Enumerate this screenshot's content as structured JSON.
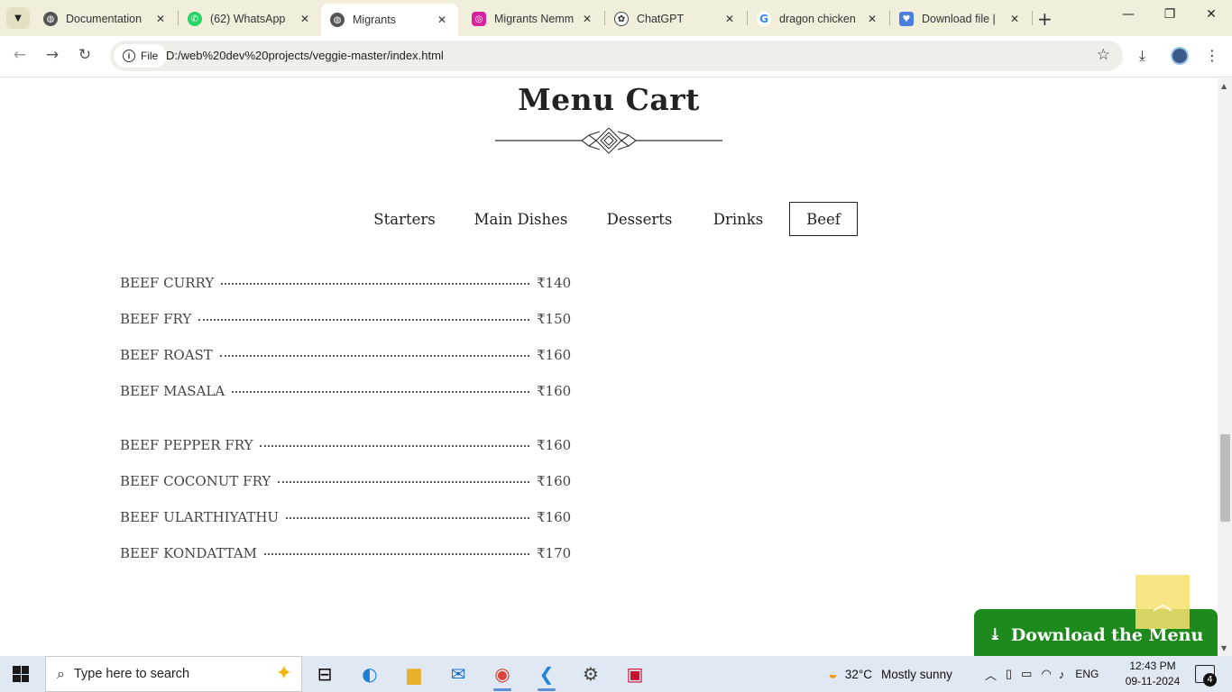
{
  "browser": {
    "tabs": [
      {
        "title": "Documentation",
        "icon": "globe-icon"
      },
      {
        "title": "(62) WhatsApp",
        "icon": "whatsapp-icon"
      },
      {
        "title": "Migrants",
        "icon": "globe-icon",
        "active": true
      },
      {
        "title": "Migrants Nemm",
        "icon": "instagram-icon"
      },
      {
        "title": "ChatGPT",
        "icon": "chatgpt-icon"
      },
      {
        "title": "dragon chicken",
        "icon": "google-icon"
      },
      {
        "title": "Download file |",
        "icon": "gemini-icon"
      }
    ],
    "new_tab": "+",
    "chip_label": "File",
    "url": "D:/web%20dev%20projects/veggie-master/index.html"
  },
  "page": {
    "title": "Menu Cart",
    "tabs": [
      {
        "label": "Starters",
        "active": false
      },
      {
        "label": "Main Dishes",
        "active": false
      },
      {
        "label": "Desserts",
        "active": false
      },
      {
        "label": "Drinks",
        "active": false
      },
      {
        "label": "Beef",
        "active": true
      }
    ],
    "items": [
      {
        "name": "BEEF CURRY",
        "price": "₹140"
      },
      {
        "name": "BEEF FRY",
        "price": "₹150"
      },
      {
        "name": "BEEF ROAST",
        "price": "₹160"
      },
      {
        "name": "BEEF MASALA",
        "price": "₹160"
      },
      {
        "name": "BEEF PEPPER FRY",
        "price": "₹160"
      },
      {
        "name": "BEEF COCONUT FRY",
        "price": "₹160"
      },
      {
        "name": "BEEF ULARTHIYATHU",
        "price": "₹160"
      },
      {
        "name": "BEEF KONDATTAM",
        "price": "₹170"
      }
    ],
    "download_label": "Download the Menu",
    "colors": {
      "download_bg": "#1e8a1e",
      "back_to_top_bg": "#f7e06e"
    }
  },
  "taskbar": {
    "search_placeholder": "Type here to search",
    "weather_temp": "32°C",
    "weather_text": "Mostly sunny",
    "language": "ENG",
    "time": "12:43 PM",
    "date": "09-11-2024",
    "notification_count": "4"
  }
}
